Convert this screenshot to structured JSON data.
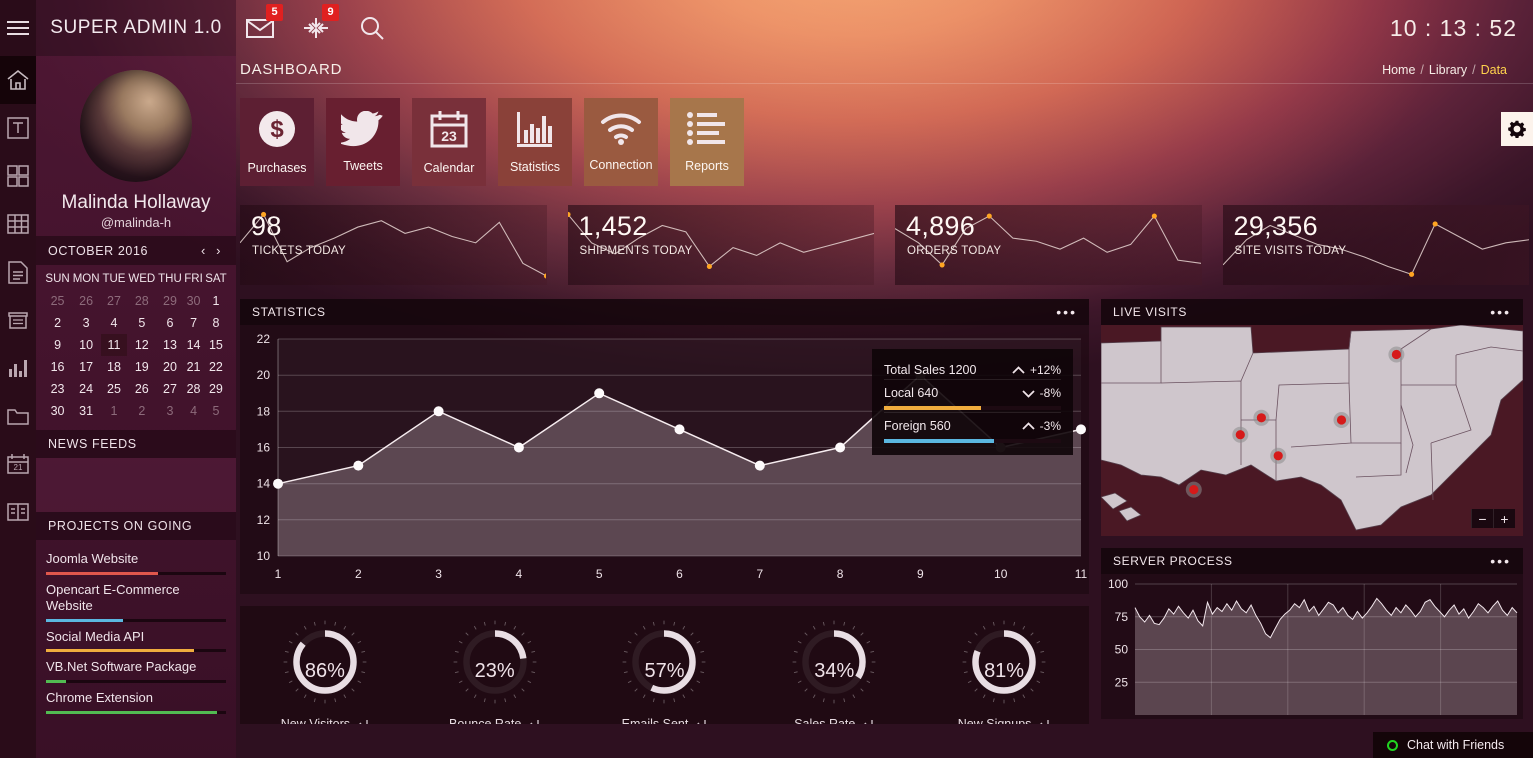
{
  "topbar": {
    "brand": "SUPER ADMIN 1.0",
    "clock": "10 : 13 : 52",
    "mail_badge": "5",
    "alert_badge": "9",
    "icons": [
      "mail-icon",
      "compress-icon",
      "search-icon"
    ]
  },
  "rail": {
    "items": [
      {
        "name": "home-icon",
        "active": true
      },
      {
        "name": "typography-icon",
        "active": false
      },
      {
        "name": "grid-icon",
        "active": false
      },
      {
        "name": "table-icon",
        "active": false
      },
      {
        "name": "document-icon",
        "active": false
      },
      {
        "name": "drawer-icon",
        "active": false
      },
      {
        "name": "bar-chart-icon",
        "active": false
      },
      {
        "name": "folder-icon",
        "active": false
      },
      {
        "name": "calendar-icon",
        "active": false
      },
      {
        "name": "book-icon",
        "active": false
      }
    ]
  },
  "profile": {
    "name": "Malinda Hollaway",
    "handle": "@malinda-h"
  },
  "calendar": {
    "title": "OCTOBER 2016",
    "prev": "‹",
    "next": "›",
    "weekdays": [
      "SUN",
      "MON",
      "TUE",
      "WED",
      "THU",
      "FRI",
      "SAT"
    ],
    "selected": "11",
    "weeks": [
      [
        {
          "d": "25",
          "mute": true
        },
        {
          "d": "26",
          "mute": true
        },
        {
          "d": "27",
          "mute": true
        },
        {
          "d": "28",
          "mute": true
        },
        {
          "d": "29",
          "mute": true
        },
        {
          "d": "30",
          "mute": true
        },
        {
          "d": "1",
          "mute": false
        }
      ],
      [
        {
          "d": "2",
          "mute": false
        },
        {
          "d": "3",
          "mute": false
        },
        {
          "d": "4",
          "mute": false
        },
        {
          "d": "5",
          "mute": false
        },
        {
          "d": "6",
          "mute": false
        },
        {
          "d": "7",
          "mute": false
        },
        {
          "d": "8",
          "mute": false
        }
      ],
      [
        {
          "d": "9",
          "mute": false
        },
        {
          "d": "10",
          "mute": false
        },
        {
          "d": "11",
          "mute": false
        },
        {
          "d": "12",
          "mute": false
        },
        {
          "d": "13",
          "mute": false
        },
        {
          "d": "14",
          "mute": false
        },
        {
          "d": "15",
          "mute": false
        }
      ],
      [
        {
          "d": "16",
          "mute": false
        },
        {
          "d": "17",
          "mute": false
        },
        {
          "d": "18",
          "mute": false
        },
        {
          "d": "19",
          "mute": false
        },
        {
          "d": "20",
          "mute": false
        },
        {
          "d": "21",
          "mute": false
        },
        {
          "d": "22",
          "mute": false
        }
      ],
      [
        {
          "d": "23",
          "mute": false
        },
        {
          "d": "24",
          "mute": false
        },
        {
          "d": "25",
          "mute": false
        },
        {
          "d": "26",
          "mute": false
        },
        {
          "d": "27",
          "mute": false
        },
        {
          "d": "28",
          "mute": false
        },
        {
          "d": "29",
          "mute": false
        }
      ],
      [
        {
          "d": "30",
          "mute": false
        },
        {
          "d": "31",
          "mute": false
        },
        {
          "d": "1",
          "mute": true
        },
        {
          "d": "2",
          "mute": true
        },
        {
          "d": "3",
          "mute": true
        },
        {
          "d": "4",
          "mute": true
        },
        {
          "d": "5",
          "mute": true
        }
      ]
    ]
  },
  "news_feeds": {
    "title": "NEWS FEEDS"
  },
  "projects": {
    "title": "PROJECTS ON GOING",
    "items": [
      {
        "label": "Joomla Website",
        "percent": 62,
        "color": "#e0574c"
      },
      {
        "label": "Opencart E-Commerce Website",
        "percent": 43,
        "color": "#5bb7e0"
      },
      {
        "label": "Social Media API",
        "percent": 82,
        "color": "#f0ad3e"
      },
      {
        "label": "VB.Net Software Package",
        "percent": 11,
        "color": "#52bb52"
      },
      {
        "label": "Chrome Extension",
        "percent": 95,
        "color": "#52bb52"
      }
    ]
  },
  "header": {
    "page_title": "DASHBOARD",
    "breadcrumb": [
      "Home",
      "Library",
      "Data"
    ],
    "separator": "/",
    "gear": "gear-icon"
  },
  "shortcuts": [
    {
      "label": "Purchases",
      "icon": "dollar-icon"
    },
    {
      "label": "Tweets",
      "icon": "twitter-bird-icon"
    },
    {
      "label": "Calendar",
      "icon": "calendar-23-icon"
    },
    {
      "label": "Statistics",
      "icon": "bar-chart-icon"
    },
    {
      "label": "Connection",
      "icon": "wifi-icon"
    },
    {
      "label": "Reports",
      "icon": "list-report-icon"
    }
  ],
  "cards": [
    {
      "value": "98",
      "caption": "TICKETS TODAY",
      "spark": [
        52,
        88,
        28,
        46,
        58,
        72,
        80,
        64,
        72,
        60,
        52,
        78,
        26,
        10
      ]
    },
    {
      "value": "1,452",
      "caption": "SHIPMENTS TODAY",
      "spark": [
        88,
        52,
        38,
        58,
        74,
        66,
        22,
        46,
        36,
        52,
        40,
        48,
        56,
        64
      ]
    },
    {
      "value": "4,896",
      "caption": "ORDERS TODAY",
      "spark": [
        70,
        52,
        24,
        70,
        86,
        58,
        54,
        44,
        58,
        40,
        50,
        86,
        30,
        26
      ]
    },
    {
      "value": "29,356",
      "caption": "SITE VISITS TODAY",
      "spark": [
        24,
        56,
        74,
        62,
        50,
        44,
        34,
        22,
        12,
        76,
        60,
        44,
        52,
        56
      ]
    }
  ],
  "statistics": {
    "title": "STATISTICS",
    "menu": "•••",
    "tooltip": {
      "rows": [
        {
          "label": "Total Sales 1200",
          "pct": "+12%",
          "dir": "up",
          "bar": null,
          "color": null
        },
        {
          "label": "Local 640",
          "pct": "-8%",
          "dir": "down",
          "bar": 55,
          "color": "#f0ad3e"
        },
        {
          "label": "Foreign 560",
          "pct": "-3%",
          "dir": "up",
          "bar": 62,
          "color": "#5bb7e0"
        }
      ]
    }
  },
  "chart_data": [
    {
      "type": "area",
      "title": "STATISTICS",
      "x": [
        1,
        2,
        3,
        4,
        5,
        6,
        7,
        8,
        9,
        10,
        11
      ],
      "values": [
        14,
        15,
        18,
        16,
        19,
        17,
        15,
        16,
        20,
        16,
        17
      ],
      "xlabel": "",
      "ylabel": "",
      "ylim": [
        10,
        22
      ],
      "yticks": [
        10,
        12,
        14,
        16,
        18,
        20,
        22
      ],
      "xticks": [
        1,
        2,
        3,
        4,
        5,
        6,
        7,
        8,
        9,
        10,
        11
      ],
      "grid": true,
      "legend": "none"
    },
    {
      "type": "area",
      "title": "SERVER PROCESS",
      "ylim": [
        0,
        100
      ],
      "yticks": [
        100,
        75,
        50,
        25
      ],
      "grid": true,
      "series": [
        {
          "name": "cpu",
          "values": [
            82,
            75,
            71,
            76,
            70,
            69,
            74,
            81,
            77,
            83,
            78,
            74,
            80,
            72,
            68,
            86,
            77,
            82,
            79,
            85,
            80,
            87,
            81,
            78,
            84,
            76,
            70,
            62,
            59,
            66,
            73,
            77,
            80,
            85,
            82,
            88,
            79,
            83,
            76,
            81,
            86,
            84,
            78,
            82,
            76,
            73,
            79,
            74,
            78,
            83,
            89,
            85,
            80,
            76,
            82,
            78,
            84,
            80,
            75,
            79,
            86,
            88,
            83,
            79,
            75,
            80,
            84,
            77,
            81,
            74,
            79,
            85,
            82,
            78,
            83,
            87,
            80,
            76,
            82,
            78
          ]
        }
      ],
      "legend": "none"
    }
  ],
  "gauges": {
    "items": [
      {
        "label": "New Visitors",
        "value": "86%",
        "percent": 86
      },
      {
        "label": "Bounce Rate",
        "value": "23%",
        "percent": 23
      },
      {
        "label": "Emails Sent",
        "value": "57%",
        "percent": 57
      },
      {
        "label": "Sales Rate",
        "value": "34%",
        "percent": 34
      },
      {
        "label": "New Signups",
        "value": "81%",
        "percent": 81
      }
    ],
    "refresh_icon": "refresh-icon"
  },
  "live_visits": {
    "title": "LIVE VISITS",
    "menu": "•••",
    "zoom_out": "−",
    "zoom_in": "+",
    "markers": [
      {
        "x": 0.7,
        "y": 0.14
      },
      {
        "x": 0.38,
        "y": 0.44
      },
      {
        "x": 0.33,
        "y": 0.52
      },
      {
        "x": 0.57,
        "y": 0.45
      },
      {
        "x": 0.42,
        "y": 0.62
      },
      {
        "x": 0.22,
        "y": 0.78
      }
    ]
  },
  "server_process": {
    "title": "SERVER PROCESS",
    "menu": "•••"
  },
  "chat": {
    "label": "Chat with Friends",
    "status_color": "#21d421"
  }
}
